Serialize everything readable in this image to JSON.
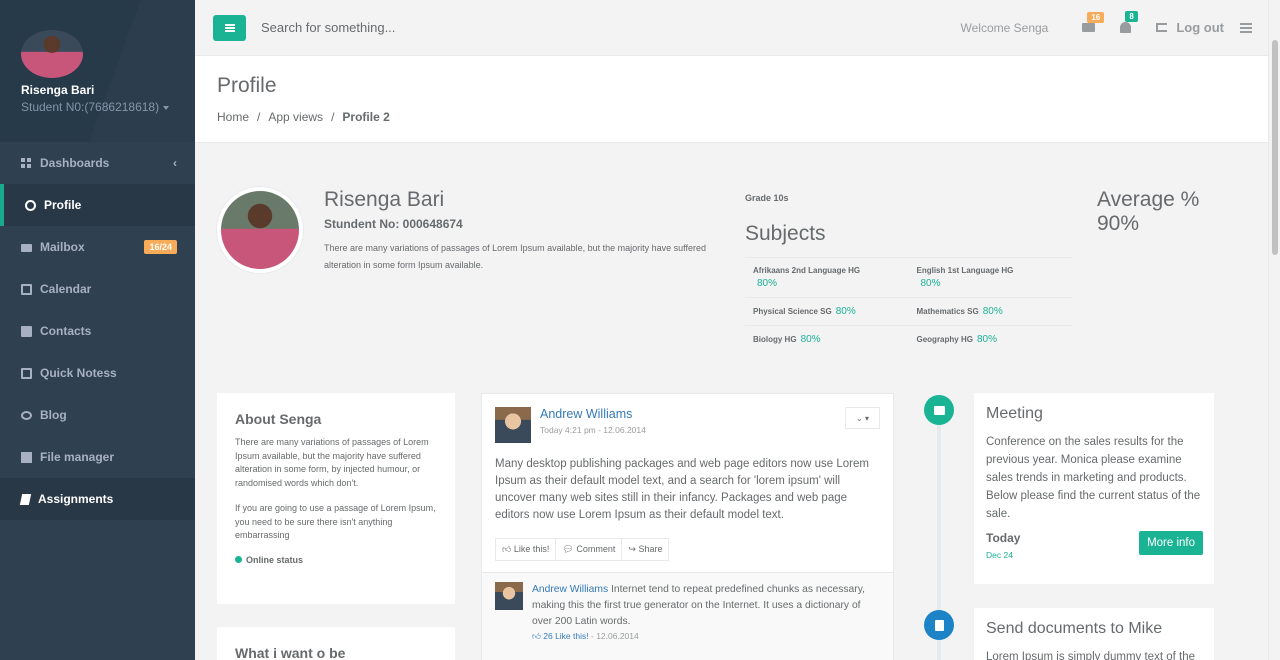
{
  "sidebar": {
    "user_name": "Risenga Bari",
    "user_sub": "Student N0:(7686218618)",
    "items": [
      {
        "label": "Dashboards",
        "icon": "grid-icon"
      },
      {
        "label": "Profile",
        "icon": "user-circle-icon"
      },
      {
        "label": "Mailbox",
        "icon": "envelope-icon",
        "badge": "16/24"
      },
      {
        "label": "Calendar",
        "icon": "calendar-icon"
      },
      {
        "label": "Contacts",
        "icon": "address-book-icon"
      },
      {
        "label": "Quick Notess",
        "icon": "edit-icon"
      },
      {
        "label": "Blog",
        "icon": "comments-icon"
      },
      {
        "label": "File manager",
        "icon": "files-icon"
      },
      {
        "label": "Assignments",
        "icon": "book-icon"
      }
    ]
  },
  "topbar": {
    "search_placeholder": "Search for something...",
    "welcome": "Welcome Senga",
    "mail_count": "16",
    "alert_count": "8",
    "logout": "Log out"
  },
  "heading": {
    "title": "Profile",
    "breadcrumb": [
      "Home",
      "App views",
      "Profile 2"
    ]
  },
  "profile": {
    "name": "Risenga Bari",
    "student_no": "Stundent No: 000648674",
    "description": "There are many variations of passages of Lorem Ipsum available, but the majority have suffered alteration in some form Ipsum available."
  },
  "subjects": {
    "grade": "Grade 10s",
    "title": "Subjects",
    "rows": [
      [
        {
          "name": "Afrikaans 2nd Language HG",
          "pct": "80%"
        },
        {
          "name": "English 1st Language HG",
          "pct": "80%"
        }
      ],
      [
        {
          "name": "Physical Science SG",
          "pct": "80%"
        },
        {
          "name": "Mathematics SG",
          "pct": "80%"
        }
      ],
      [
        {
          "name": "Biology HG",
          "pct": "80%"
        },
        {
          "name": "Geography HG",
          "pct": "80%"
        }
      ]
    ]
  },
  "average": {
    "label": "Average %",
    "value": "90%"
  },
  "about": {
    "title": "About Senga",
    "p1": "There are many variations of passages of Lorem Ipsum available, but the majority have suffered alteration in some form, by injected humour, or randomised words which don't.",
    "p2": "If you are going to use a passage of Lorem Ipsum, you need to be sure there isn't anything embarrassing",
    "status": "Online status",
    "next_title": "What i want o be"
  },
  "feed": {
    "author": "Andrew Williams",
    "time": "Today 4:21 pm - 12.06.2014",
    "text": "Many desktop publishing packages and web page editors now use Lorem Ipsum as their default model text, and a search for 'lorem ipsum' will uncover many web sites still in their infancy. Packages and web page editors now use Lorem Ipsum as their default model text.",
    "actions": {
      "like": "Like this!",
      "comment": "Comment",
      "share": "Share"
    },
    "comment": {
      "author": "Andrew Williams",
      "text": "Internet tend to repeat predefined chunks as necessary, making this the first true generator on the Internet. It uses a dictionary of over 200 Latin words.",
      "likes": "26 Like this!",
      "date": "- 12.06.2014"
    }
  },
  "timeline": {
    "items": [
      {
        "title": "Meeting",
        "text": "Conference on the sales results for the previous year. Monica please examine sales trends in marketing and products. Below please find the current status of the sale.",
        "when": "Today",
        "date": "Dec 24",
        "button": "More info",
        "icon": "briefcase-icon"
      },
      {
        "title": "Send documents to Mike",
        "text": "Lorem Ipsum is simply dummy text of the",
        "icon": "file-text-icon"
      }
    ]
  },
  "colors": {
    "primary": "#1ab394",
    "warning": "#f8ac59",
    "info": "#1c84c6",
    "sidebar": "#2f4050"
  }
}
